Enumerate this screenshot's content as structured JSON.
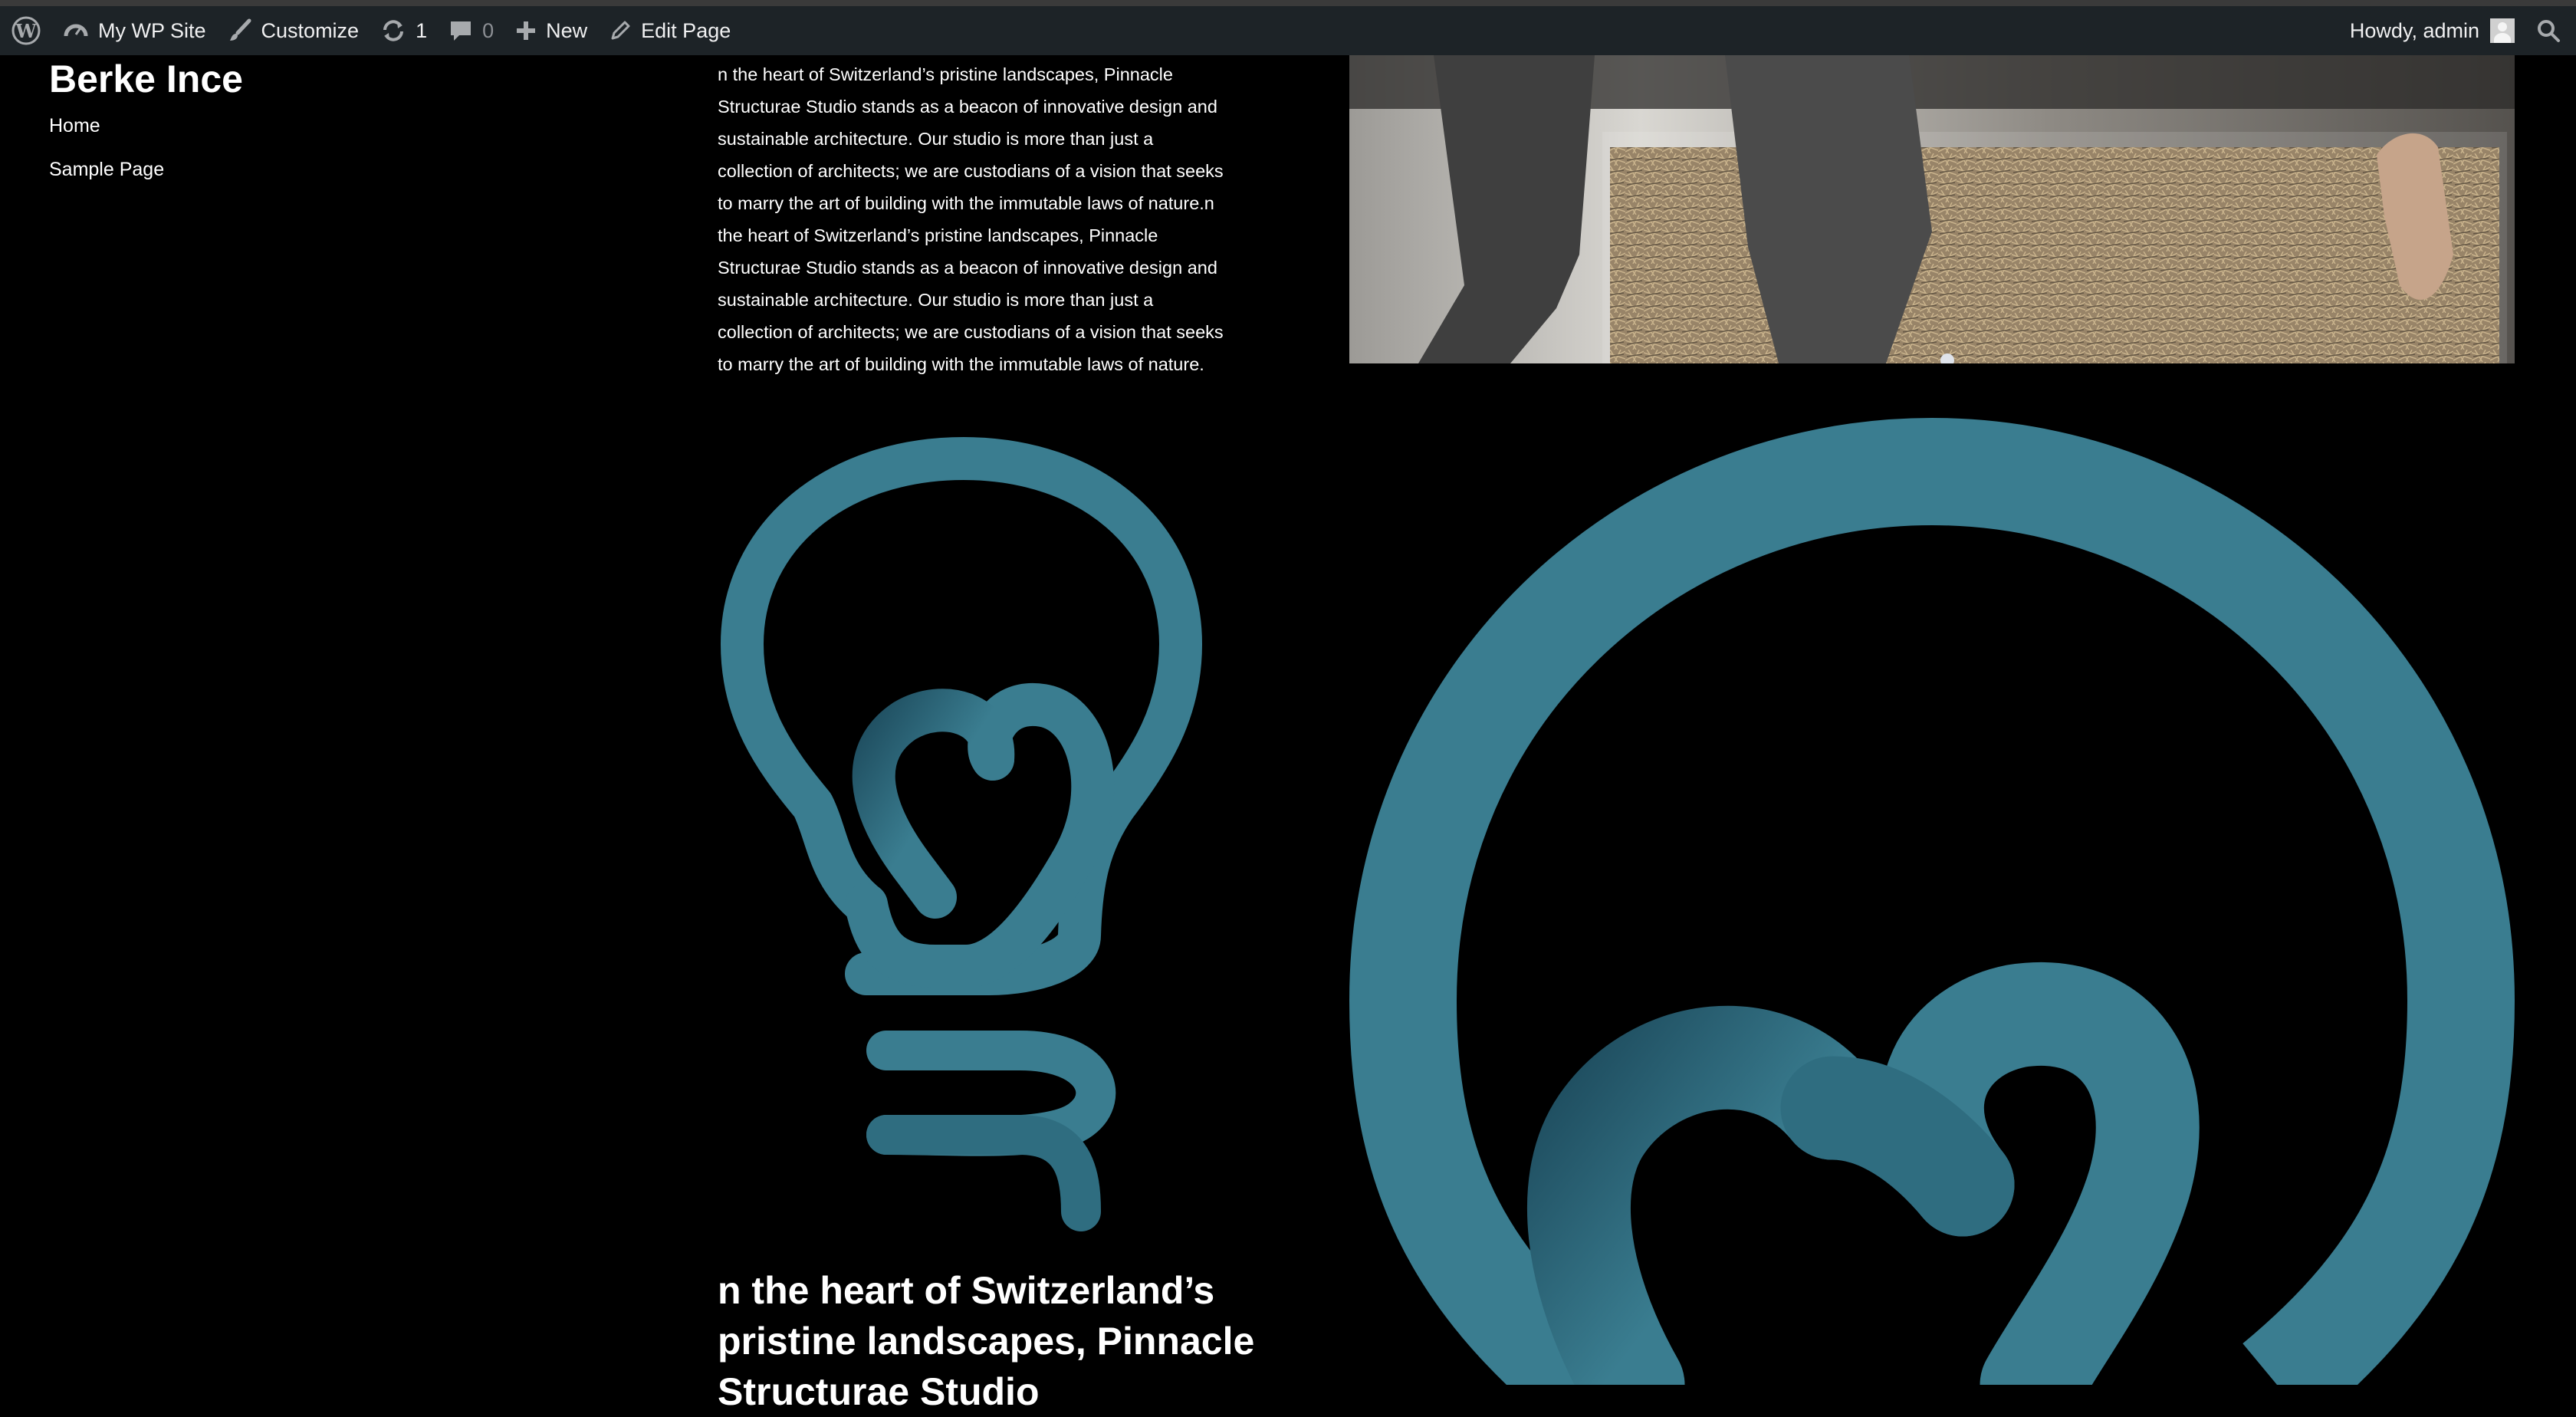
{
  "adminbar": {
    "site_name": "My WP Site",
    "customize": "Customize",
    "updates_count": "1",
    "comments_count": "0",
    "new_label": "New",
    "edit_page": "Edit Page",
    "greeting": "Howdy, admin"
  },
  "site": {
    "title": "Berke Ince",
    "nav": [
      "Home",
      "Sample Page"
    ]
  },
  "content": {
    "paragraph": "n the heart of Switzerland’s pristine landscapes, Pinnacle Structurae Studio stands as a beacon of innovative design and sustainable architecture. Our studio is more than just a collection of architects; we are custodians of a vision that seeks to marry the art of building with the immutable laws of nature.n the heart of Switzerland’s pristine landscapes, Pinnacle Structurae Studio stands as a beacon of innovative design and sustainable architecture. Our studio is more than just a collection of architects; we are custodians of a vision that seeks to marry the art of building with the immutable laws of nature.",
    "heading": "n the heart of Switzerland’s pristine landscapes, Pinnacle Structurae Studio"
  },
  "colors": {
    "logo_teal": "#3a7d90",
    "adminbar_bg": "#1d2327"
  },
  "icons": [
    "wordpress-icon",
    "dashboard-icon",
    "brush-icon",
    "refresh-icon",
    "comment-icon",
    "plus-icon",
    "pencil-icon",
    "search-icon"
  ]
}
